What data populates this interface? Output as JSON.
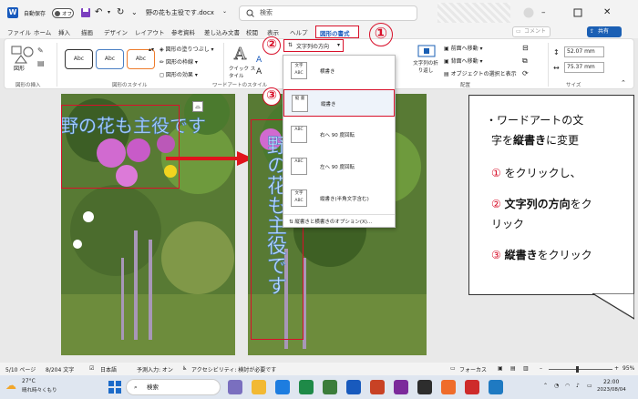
{
  "titlebar": {
    "autosave_label": "自動保存",
    "autosave_state": "オフ",
    "doc_name": "野の花も主役です.docx",
    "search_placeholder": "検索"
  },
  "menu": {
    "tabs": [
      "ファイル",
      "ホーム",
      "挿入",
      "描画",
      "デザイン",
      "レイアウト",
      "参考資料",
      "差し込み文書",
      "校閲",
      "表示",
      "ヘルプ",
      "図形の書式"
    ],
    "comment_label": "コメント",
    "share_label": "共有"
  },
  "ribbon": {
    "insert_shape_group": "図形の挿入",
    "shapes_label": "図形",
    "style_group": "図形のスタイル",
    "style_swatch_text": "Abc",
    "fill_label": "図形の塗りつぶし",
    "outline_label": "図形の枠線",
    "effect_label": "図形の効果",
    "quick_style_label": "クイック スタイル",
    "wordart_group": "ワードアートのスタイル",
    "text_dir_label": "文字列の方向",
    "text_wrap_label": "文字列の折り返し",
    "bring_forward": "前面へ移動",
    "send_backward": "背面へ移動",
    "selection_pane": "オブジェクトの選択と表示",
    "arrange_group": "配置",
    "size_group": "サイズ",
    "height_value": "52.07 mm",
    "width_value": "75.37 mm"
  },
  "dropdown": {
    "items": [
      {
        "icon_text": "文字 ABC",
        "label": "横書き"
      },
      {
        "icon_text": "縦 書",
        "label": "縦書き"
      },
      {
        "icon_text": "ABC",
        "label": "右へ 90 度回転"
      },
      {
        "icon_text": "ABC",
        "label": "左へ 90 度回転"
      },
      {
        "icon_text": "文字 ABC",
        "label": "縦書き(半角文字含む)"
      }
    ],
    "options_label": "縦書きと横書きのオプション(X)..."
  },
  "callouts": [
    "①",
    "②",
    "③"
  ],
  "document": {
    "wordart_left": "野の花も主役です",
    "wordart_right": "野の花も主役です"
  },
  "note": {
    "line1": "・ワードアートの文",
    "line2_a": "字を",
    "line2_b": "縦書き",
    "line2_c": "に変更",
    "line3_num": "①",
    "line3_text": "をクリックし、",
    "line4_num": "②",
    "line4_bold": "文字列の方向",
    "line4_text": "をク",
    "line5": "リック",
    "line6_num": "③",
    "line6_bold": "縦書き",
    "line6_text": "をクリック"
  },
  "statusbar": {
    "page": "5/10 ページ",
    "words": "8/204 文字",
    "lang": "日本語",
    "input": "予測入力: オン",
    "access": "アクセシビリティ: 検討が必要です",
    "focus": "フォーカス",
    "zoom": "95%"
  },
  "taskbar": {
    "weather_temp": "27°C",
    "weather_desc": "晴れ時々くもり",
    "search_label": "検索",
    "time": "22:00",
    "date": "2023/08/04"
  }
}
